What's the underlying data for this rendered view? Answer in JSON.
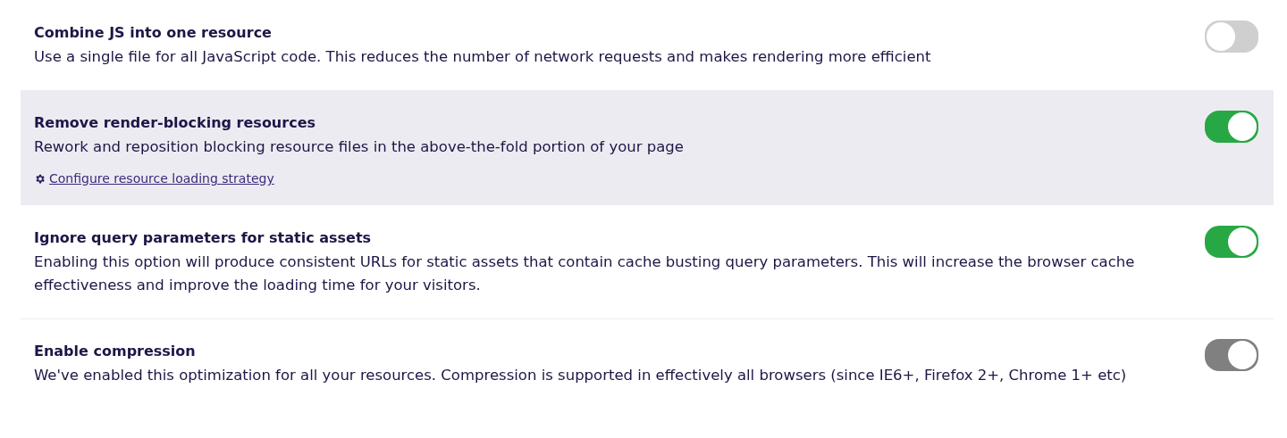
{
  "settings": [
    {
      "title": "Combine JS into one resource",
      "description": "Use a single file for all JavaScript code. This reduces the number of network requests and makes rendering more efficient",
      "on": false,
      "disabled": false,
      "highlighted": false
    },
    {
      "title": "Remove render-blocking resources",
      "description": "Rework and reposition blocking resource files in the above-the-fold portion of your page",
      "link": "Configure resource loading strategy",
      "on": true,
      "disabled": false,
      "highlighted": true
    },
    {
      "title": "Ignore query parameters for static assets",
      "description": "Enabling this option will produce consistent URLs for static assets that contain cache busting query parameters. This will increase the browser cache effectiveness and improve the loading time for your visitors.",
      "on": true,
      "disabled": false,
      "highlighted": false
    },
    {
      "title": "Enable compression",
      "description": "We've enabled this optimization for all your resources. Compression is supported in effectively all browsers (since IE6+, Firefox 2+, Chrome 1+ etc)",
      "on": true,
      "disabled": true,
      "highlighted": false
    }
  ]
}
